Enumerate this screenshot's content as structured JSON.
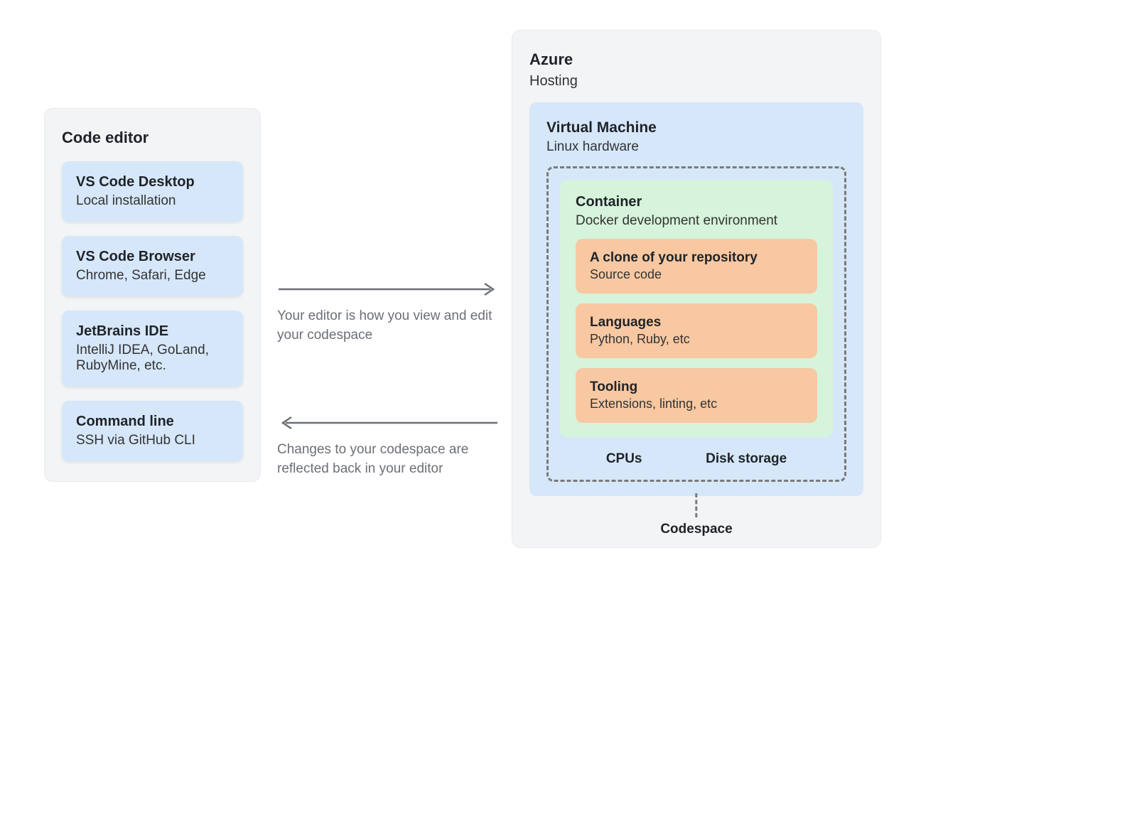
{
  "editor_panel": {
    "title": "Code editor",
    "items": [
      {
        "title": "VS Code Desktop",
        "sub": "Local installation"
      },
      {
        "title": "VS Code Browser",
        "sub": "Chrome, Safari, Edge"
      },
      {
        "title": "JetBrains IDE",
        "sub": "IntelliJ IDEA, GoLand, RubyMine, etc."
      },
      {
        "title": "Command line",
        "sub": "SSH via GitHub CLI"
      }
    ]
  },
  "arrows": {
    "right_caption": "Your editor is how you view and edit your codespace",
    "left_caption": "Changes to your codespace are reflected back in your editor"
  },
  "azure": {
    "title": "Azure",
    "sub": "Hosting",
    "vm": {
      "title": "Virtual Machine",
      "sub": "Linux hardware",
      "container": {
        "title": "Container",
        "sub": "Docker development environment",
        "items": [
          {
            "title": "A clone of your repository",
            "sub": "Source code"
          },
          {
            "title": "Languages",
            "sub": "Python, Ruby, etc"
          },
          {
            "title": "Tooling",
            "sub": "Extensions, linting, etc"
          }
        ]
      },
      "hw": {
        "cpus": "CPUs",
        "disk": "Disk storage"
      },
      "codespace_label": "Codespace"
    }
  }
}
